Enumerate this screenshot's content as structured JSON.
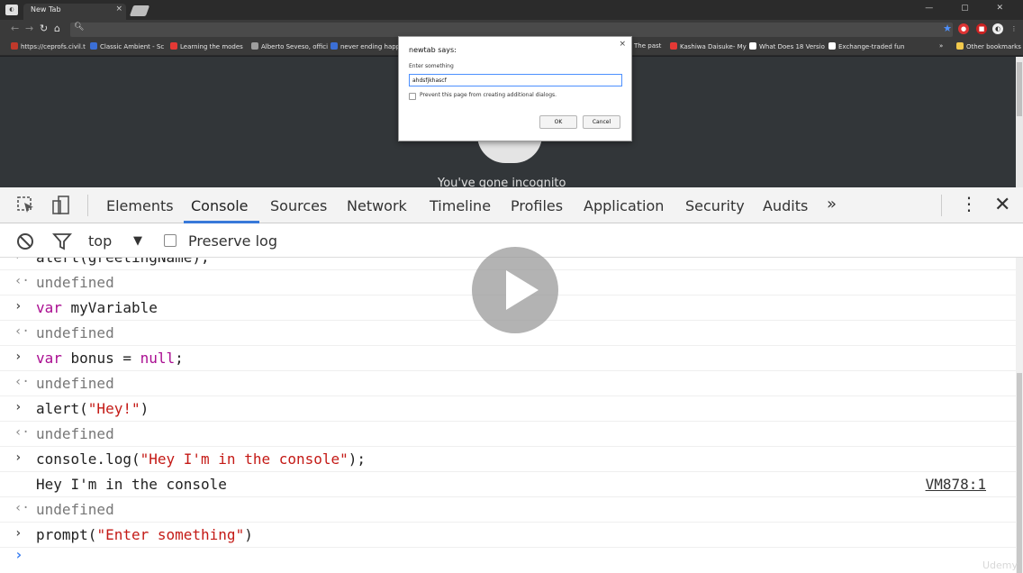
{
  "browser": {
    "tab_title": "New Tab",
    "tab_close": "×",
    "window_controls": "— ▢ ✕",
    "bookmarks": [
      {
        "label": "https://ceprofs.civil.t",
        "color": "#c0392b"
      },
      {
        "label": "Classic Ambient - Sc",
        "color": "#3b6fd6"
      },
      {
        "label": "Learning the modes",
        "color": "#e53935"
      },
      {
        "label": "Alberto Seveso, offici",
        "color": "#9e9e9e"
      },
      {
        "label": "never ending happe",
        "color": "#3b6fd6"
      },
      {
        "label": "The past",
        "color": "#9e9e9e"
      },
      {
        "label": "Kashiwa Daisuke- My",
        "color": "#e53935"
      },
      {
        "label": "What Does 18 Versio",
        "color": "#ffffff"
      },
      {
        "label": "Exchange-traded fun",
        "color": "#ffffff"
      },
      {
        "label": "»",
        "color": ""
      },
      {
        "label": "Other bookmarks",
        "color": "#f2c94c"
      }
    ]
  },
  "page": {
    "incognito_text": "You've gone incognito"
  },
  "dialog": {
    "title": "newtab says:",
    "close": "×",
    "label": "Enter something",
    "input_value": "ahdsfjkhascf",
    "checkbox_label": "Prevent this page from creating additional dialogs.",
    "ok_label": "OK",
    "cancel_label": "Cancel"
  },
  "devtools": {
    "tabs": [
      "Elements",
      "Console",
      "Sources",
      "Network",
      "Timeline",
      "Profiles",
      "Application",
      "Security",
      "Audits"
    ],
    "active_tab": "Console",
    "more": "»",
    "close": "✕",
    "filter": {
      "context": "top",
      "preserve_log": "Preserve log"
    },
    "console_rows": [
      {
        "kind": "in",
        "text": "alert(greetingName);"
      },
      {
        "kind": "out",
        "text": "undefined"
      },
      {
        "kind": "in",
        "text": "var myVariable"
      },
      {
        "kind": "out",
        "text": "undefined"
      },
      {
        "kind": "in",
        "text": "var bonus = null;"
      },
      {
        "kind": "out",
        "text": "undefined"
      },
      {
        "kind": "in",
        "text": "alert(\"Hey!\")"
      },
      {
        "kind": "out",
        "text": "undefined"
      },
      {
        "kind": "in",
        "text": "console.log(\"Hey I'm in the console\");"
      },
      {
        "kind": "log",
        "text": "Hey I'm in the console",
        "source": "VM878:1"
      },
      {
        "kind": "out",
        "text": "undefined"
      },
      {
        "kind": "in",
        "text": "prompt(\"Enter something\")"
      }
    ]
  },
  "watermark": "Udemy"
}
